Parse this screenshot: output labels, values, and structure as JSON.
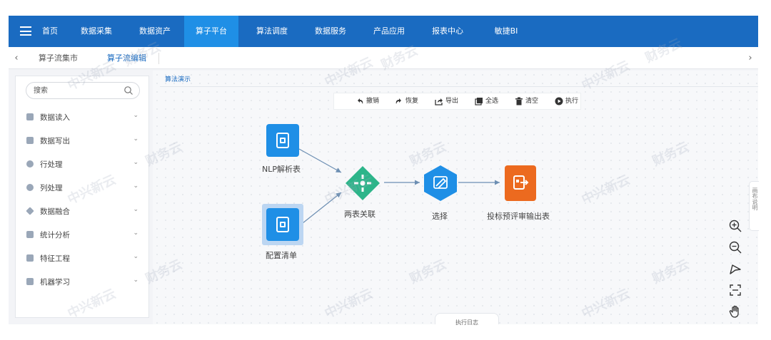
{
  "nav": {
    "items": [
      "首页",
      "数据采集",
      "数据资产",
      "算子平台",
      "算法调度",
      "数据服务",
      "产品应用",
      "报表中心",
      "敏捷BI"
    ]
  },
  "tabs": {
    "items": [
      "算子流集市",
      "算子流编辑"
    ],
    "left_arrow": "‹",
    "right_arrow": "›"
  },
  "sidebar": {
    "search_placeholder": "搜索",
    "items": [
      "数据读入",
      "数据写出",
      "行处理",
      "列处理",
      "数据融合",
      "统计分析",
      "特征工程",
      "机器学习"
    ]
  },
  "canvas": {
    "tab_label": "算法演示",
    "toolbar": [
      "撤销",
      "恢复",
      "导出",
      "全选",
      "清空",
      "执行"
    ],
    "nodes": {
      "nlp": "NLP解析表",
      "config": "配置清单",
      "join": "两表关联",
      "select": "选择",
      "output": "投标预评审输出表"
    },
    "side_panel_label": "画布说明",
    "log_label": "执行日志"
  },
  "watermark": {
    "text": "财务云",
    "text2": "中兴新云"
  },
  "colors": {
    "nav_bg": "#1a6bc1",
    "nav_active": "#1f8fe6",
    "node_blue": "#1f8fe6",
    "node_green": "#2db58a",
    "node_orange": "#ec6a1f",
    "node_selected": "#bcd6f2"
  }
}
